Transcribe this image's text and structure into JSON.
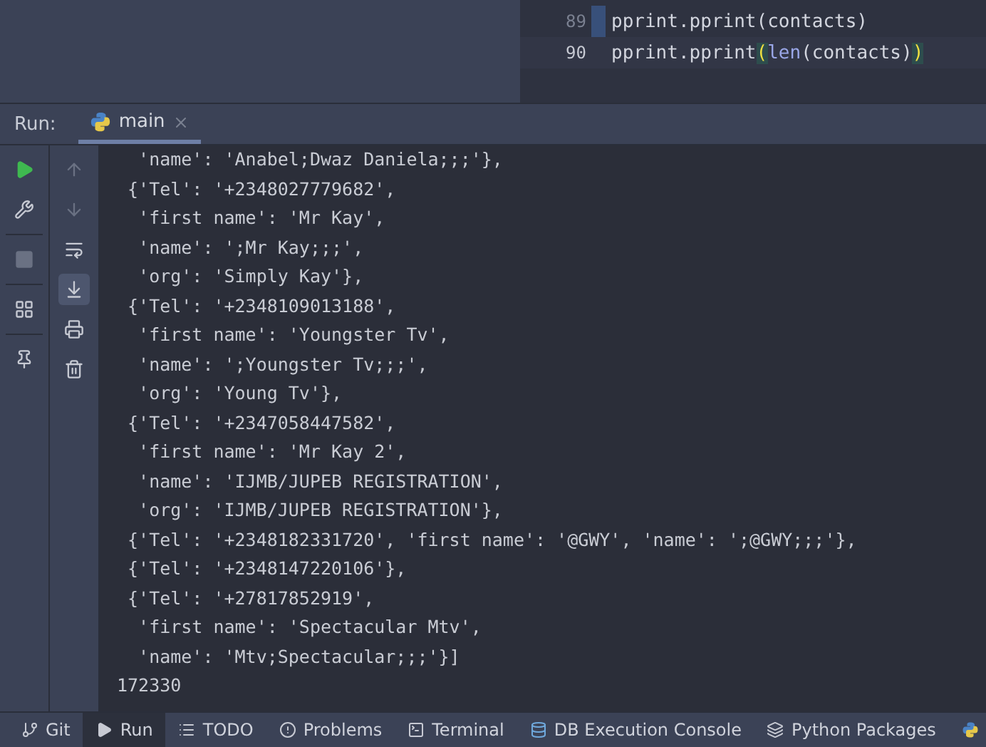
{
  "editor": {
    "lines": [
      {
        "number": "89",
        "current": false,
        "tokens": [
          {
            "kind": "plain",
            "text": "pprint.pprint(contacts)"
          }
        ]
      },
      {
        "number": "90",
        "current": true,
        "tokens": [
          {
            "kind": "plain",
            "text": "pprint.pprint"
          },
          {
            "kind": "brace",
            "text": "("
          },
          {
            "kind": "builtin",
            "text": "len"
          },
          {
            "kind": "plain",
            "text": "(contacts)"
          },
          {
            "kind": "brace",
            "text": ")"
          }
        ]
      }
    ]
  },
  "run_panel": {
    "label": "Run:",
    "tabs": [
      {
        "label": "main",
        "selected": true
      }
    ],
    "left_tools": [
      {
        "kind": "play"
      },
      {
        "kind": "wrench"
      },
      {
        "kind": "stop"
      },
      {
        "kind": "layout"
      },
      {
        "kind": "pin"
      }
    ],
    "right_tools": [
      {
        "kind": "up",
        "selected": false
      },
      {
        "kind": "down",
        "selected": false
      },
      {
        "kind": "wrap",
        "selected": false
      },
      {
        "kind": "scroll-end",
        "selected": true
      },
      {
        "kind": "print",
        "selected": false
      },
      {
        "kind": "trash",
        "selected": false
      }
    ],
    "output": [
      "  'name': 'Anabel;Dwaz Daniela;;;'},",
      " {'Tel': '+2348027779682',",
      "  'first name': 'Mr Kay',",
      "  'name': ';Mr Kay;;;',",
      "  'org': 'Simply Kay'},",
      " {'Tel': '+2348109013188',",
      "  'first name': 'Youngster Tv',",
      "  'name': ';Youngster Tv;;;',",
      "  'org': 'Young Tv'},",
      " {'Tel': '+2347058447582',",
      "  'first name': 'Mr Kay 2',",
      "  'name': 'IJMB/JUPEB REGISTRATION',",
      "  'org': 'IJMB/JUPEB REGISTRATION'},",
      " {'Tel': '+2348182331720', 'first name': '@GWY', 'name': ';@GWY;;;'},",
      " {'Tel': '+2348147220106'},",
      " {'Tel': '+27817852919',",
      "  'first name': 'Spectacular Mtv',",
      "  'name': 'Mtv;Spectacular;;;'}]",
      "172330"
    ]
  },
  "bottom_tabs": [
    {
      "kind": "git",
      "label": "Git",
      "selected": false
    },
    {
      "kind": "run",
      "label": "Run",
      "selected": true
    },
    {
      "kind": "todo",
      "label": "TODO",
      "selected": false
    },
    {
      "kind": "problems",
      "label": "Problems",
      "selected": false
    },
    {
      "kind": "terminal",
      "label": "Terminal",
      "selected": false
    },
    {
      "kind": "db",
      "label": "DB Execution Console",
      "selected": false
    },
    {
      "kind": "packages",
      "label": "Python Packages",
      "selected": false
    },
    {
      "kind": "python",
      "selected": false
    }
  ]
}
